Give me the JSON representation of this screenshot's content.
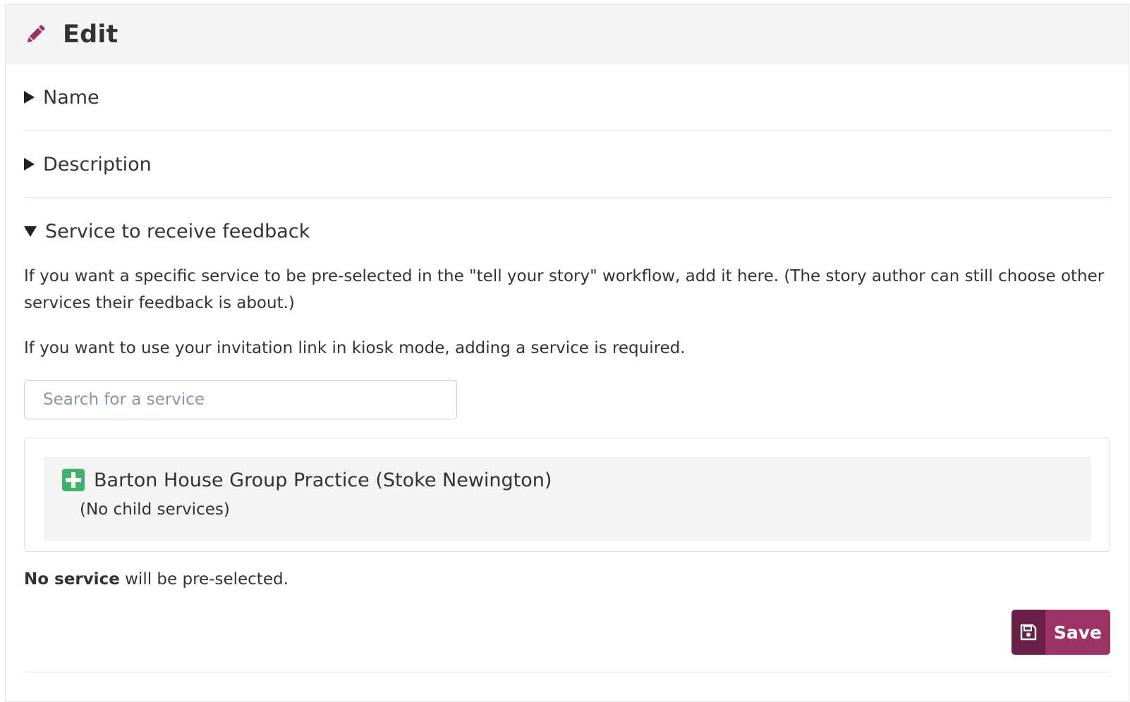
{
  "header": {
    "title": "Edit",
    "icon": "pencil-icon",
    "icon_color": "#9b3465"
  },
  "sections": {
    "name": {
      "label": "Name",
      "state": "collapsed"
    },
    "description": {
      "label": "Description",
      "state": "collapsed"
    },
    "service": {
      "label": "Service to receive feedback",
      "state": "expanded",
      "paragraph_1": "If you want a specific service to be pre-selected in the \"tell your story\" workflow, add it here. (The story author can still choose other services their feedback is about.)",
      "paragraph_2": "If you want to use your invitation link in kiosk mode, adding a service is required.",
      "search": {
        "placeholder": "Search for a service",
        "value": ""
      },
      "result": {
        "icon": "plus-square-icon",
        "icon_color": "#3fb26b",
        "name": "Barton House Group Practice (Stoke Newington)",
        "children_note": "(No child services)"
      },
      "status_bold": "No service",
      "status_rest": " will be pre-selected."
    }
  },
  "actions": {
    "save_label": "Save",
    "save_icon": "floppy-disk-icon",
    "button_color": "#9b3465",
    "icon_bg_color": "#6a1f46"
  }
}
